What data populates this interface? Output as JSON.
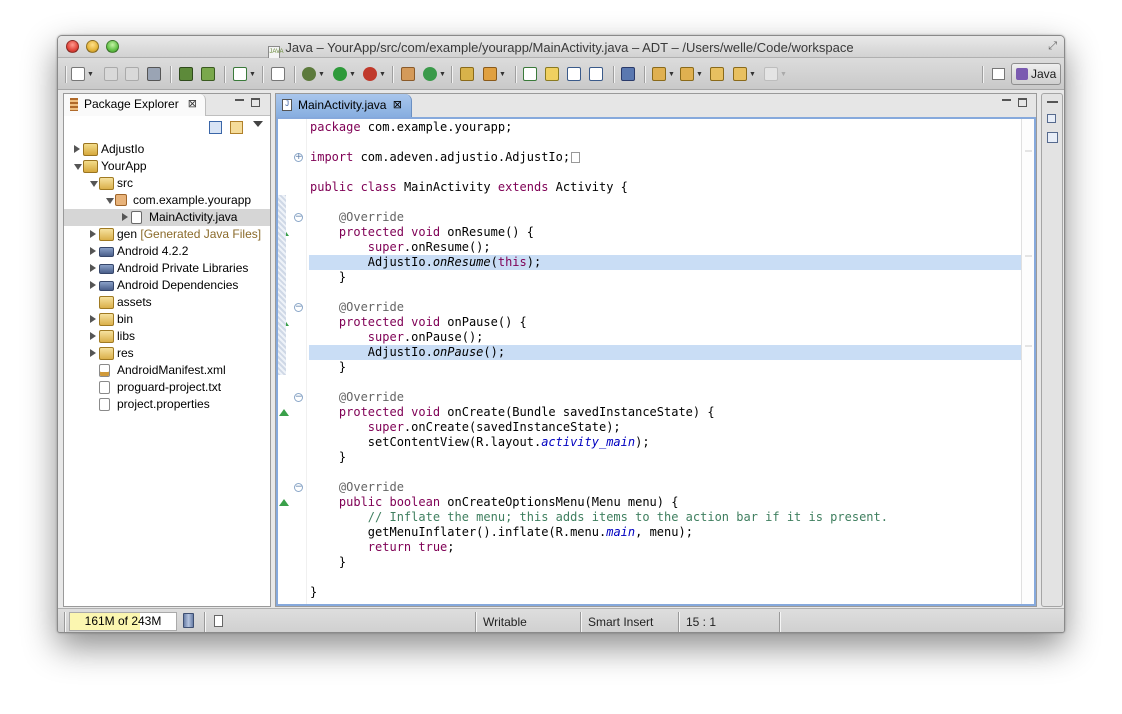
{
  "window": {
    "title": "Java – YourApp/src/com/example/yourapp/MainActivity.java – ADT – /Users/welle/Code/workspace",
    "title_icon_text": "JAVA"
  },
  "toolbar": {
    "perspective_label": "Java"
  },
  "package_explorer": {
    "tab_label": "Package Explorer",
    "close_glyph": "⊠",
    "tree": [
      {
        "label": "AdjustIo",
        "icon": "project-icon",
        "depth": 0,
        "expander": "closed"
      },
      {
        "label": "YourApp",
        "icon": "project-icon",
        "depth": 0,
        "expander": "open"
      },
      {
        "label": "src",
        "icon": "source-folder-icon",
        "depth": 1,
        "expander": "open"
      },
      {
        "label": "com.example.yourapp",
        "icon": "package-icon",
        "depth": 2,
        "expander": "open"
      },
      {
        "label": "MainActivity.java",
        "icon": "java-file-icon",
        "depth": 3,
        "expander": "closed",
        "selected": true
      },
      {
        "label": "gen",
        "note": "[Generated Java Files]",
        "icon": "source-folder-icon",
        "depth": 1,
        "expander": "closed"
      },
      {
        "label": "Android 4.2.2",
        "icon": "library-icon",
        "depth": 1,
        "expander": "closed"
      },
      {
        "label": "Android Private Libraries",
        "icon": "library-icon",
        "depth": 1,
        "expander": "closed"
      },
      {
        "label": "Android Dependencies",
        "icon": "library-icon",
        "depth": 1,
        "expander": "closed"
      },
      {
        "label": "assets",
        "icon": "folder-icon",
        "depth": 1,
        "expander": "none"
      },
      {
        "label": "bin",
        "icon": "folder-icon",
        "depth": 1,
        "expander": "closed"
      },
      {
        "label": "libs",
        "icon": "folder-icon",
        "depth": 1,
        "expander": "closed"
      },
      {
        "label": "res",
        "icon": "folder-icon",
        "depth": 1,
        "expander": "closed"
      },
      {
        "label": "AndroidManifest.xml",
        "icon": "xml-file-icon",
        "depth": 1,
        "expander": "none"
      },
      {
        "label": "proguard-project.txt",
        "icon": "text-file-icon",
        "depth": 1,
        "expander": "none"
      },
      {
        "label": "project.properties",
        "icon": "text-file-icon",
        "depth": 1,
        "expander": "none"
      }
    ]
  },
  "editor": {
    "tab_label": "MainActivity.java",
    "tab_icon_text": "J",
    "close_glyph": "⊠",
    "lines": [
      [
        [
          "kw",
          "package"
        ],
        [
          "",
          "com.example.yourapp;"
        ]
      ],
      [],
      [
        [
          "kw",
          "import"
        ],
        [
          "",
          "com.adeven.adjustio.AdjustIo;"
        ]
      ],
      [],
      [
        [
          "kw",
          "public"
        ],
        [
          "",
          ""
        ],
        [
          "kw",
          "class"
        ],
        [
          "",
          "MainActivity"
        ],
        [
          "kw",
          "extends"
        ],
        [
          "",
          "Activity {"
        ]
      ],
      [],
      [
        [
          "ann",
          "    @Override"
        ]
      ],
      [
        [
          "kw",
          "    protected"
        ],
        [
          "kw",
          "void"
        ],
        [
          "",
          "onResume() {"
        ]
      ],
      [
        [
          "kw",
          "        super"
        ],
        [
          "",
          ".onResume();"
        ]
      ],
      [
        [
          "",
          "        AdjustIo."
        ],
        [
          "it",
          "onResume"
        ],
        [
          "",
          "("
        ],
        [
          "kw",
          "this"
        ],
        [
          "",
          ");"
        ]
      ],
      [
        [
          "",
          "    }"
        ]
      ],
      [],
      [
        [
          "ann",
          "    @Override"
        ]
      ],
      [
        [
          "kw",
          "    protected"
        ],
        [
          "kw",
          "void"
        ],
        [
          "",
          "onPause() {"
        ]
      ],
      [
        [
          "kw",
          "        super"
        ],
        [
          "",
          ".onPause();"
        ]
      ],
      [
        [
          "",
          "        AdjustIo."
        ],
        [
          "it",
          "onPause"
        ],
        [
          "",
          "();"
        ]
      ],
      [
        [
          "",
          "    }"
        ]
      ],
      [],
      [
        [
          "ann",
          "    @Override"
        ]
      ],
      [
        [
          "kw",
          "    protected"
        ],
        [
          "kw",
          "void"
        ],
        [
          "",
          "onCreate(Bundle savedInstanceState) {"
        ]
      ],
      [
        [
          "kw",
          "        super"
        ],
        [
          "",
          ".onCreate(savedInstanceState);"
        ]
      ],
      [
        [
          "",
          "        setContentView(R.layout."
        ],
        [
          "fld",
          "activity_main"
        ],
        [
          "",
          ");"
        ]
      ],
      [
        [
          "",
          "    }"
        ]
      ],
      [],
      [
        [
          "ann",
          "    @Override"
        ]
      ],
      [
        [
          "kw",
          "    public"
        ],
        [
          "kw",
          "boolean"
        ],
        [
          "",
          "onCreateOptionsMenu(Menu menu) {"
        ]
      ],
      [
        [
          "cmt",
          "        // Inflate the menu; this adds items to the action bar if it is present."
        ]
      ],
      [
        [
          "",
          "        getMenuInflater().inflate(R.menu."
        ],
        [
          "fld",
          "main"
        ],
        [
          "",
          ", menu);"
        ]
      ],
      [
        [
          "kw",
          "        return"
        ],
        [
          "kw",
          "true"
        ],
        [
          "",
          ";"
        ]
      ],
      [
        [
          "",
          "    }"
        ]
      ],
      [],
      [
        [
          "",
          "}"
        ]
      ]
    ],
    "highlighted_lines": [
      9,
      15
    ],
    "fold_lines": [
      2,
      6,
      12,
      18,
      24
    ],
    "override_lines": [
      7,
      13,
      19,
      25
    ],
    "collapsed_import_line": 2
  },
  "statusbar": {
    "heap": "161M of 243M",
    "heap_fraction": 0.66,
    "writable": "Writable",
    "insert_mode": "Smart Insert",
    "position": "15 : 1"
  },
  "colors": {
    "keyword": "#7f0055",
    "annotation": "#646464",
    "field": "#0000c0",
    "comment": "#3f7f5f",
    "line_highlight": "#c9ddf5",
    "editor_border": "#86a9dc"
  }
}
